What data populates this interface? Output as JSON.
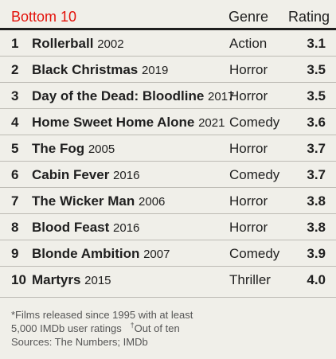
{
  "header": {
    "title": "Bottom 10",
    "genre_label": "Genre",
    "rating_label": "Rating"
  },
  "rows": [
    {
      "rank": "1",
      "title": "Rollerball",
      "year": "2002",
      "genre": "Action",
      "rating": "3.1"
    },
    {
      "rank": "2",
      "title": "Black Christmas",
      "year": "2019",
      "genre": "Horror",
      "rating": "3.5"
    },
    {
      "rank": "3",
      "title": "Day of the Dead: Bloodline",
      "year": "2017",
      "genre": "Horror",
      "rating": "3.5"
    },
    {
      "rank": "4",
      "title": "Home Sweet Home Alone",
      "year": "2021",
      "genre": "Comedy",
      "rating": "3.6"
    },
    {
      "rank": "5",
      "title": "The Fog",
      "year": "2005",
      "genre": "Horror",
      "rating": "3.7"
    },
    {
      "rank": "6",
      "title": "Cabin Fever",
      "year": "2016",
      "genre": "Comedy",
      "rating": "3.7"
    },
    {
      "rank": "7",
      "title": "The Wicker Man",
      "year": "2006",
      "genre": "Horror",
      "rating": "3.8"
    },
    {
      "rank": "8",
      "title": "Blood Feast",
      "year": "2016",
      "genre": "Horror",
      "rating": "3.8"
    },
    {
      "rank": "9",
      "title": "Blonde Ambition",
      "year": "2007",
      "genre": "Comedy",
      "rating": "3.9"
    },
    {
      "rank": "10",
      "title": "Martyrs",
      "year": "2015",
      "genre": "Thriller",
      "rating": "4.0"
    }
  ],
  "footnote": {
    "line1": "*Films released since 1995 with at least",
    "line2_text": "5,000 IMDb user ratings",
    "line2_mark": "†",
    "line2_note": "Out of ten",
    "line3": "Sources: The Numbers; IMDb"
  },
  "colors": {
    "accent": "#e3120b",
    "background": "#f0efe9",
    "text": "#1f1f1f"
  }
}
